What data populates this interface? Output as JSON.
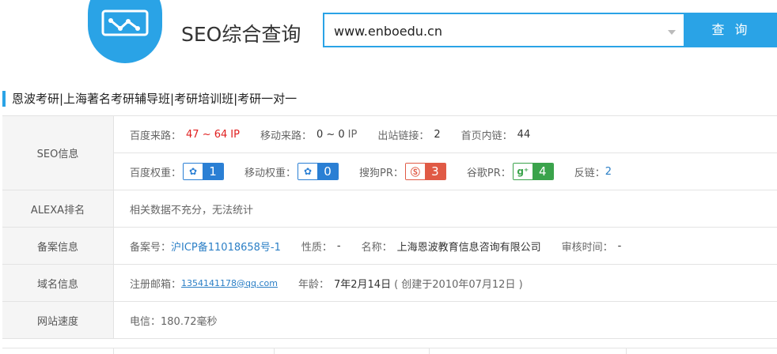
{
  "header": {
    "title": "SEO综合查询",
    "search_value": "www.enboedu.cn",
    "search_button": "查 询"
  },
  "site_title": "恩波考研|上海著名考研辅导班|考研培训班|考研一对一",
  "seo": {
    "label": "SEO信息",
    "baidu_traffic_label": "百度来路：",
    "baidu_traffic_value": "47 ~ 64",
    "baidu_traffic_unit": "IP",
    "mobile_traffic_label": "移动来路：",
    "mobile_traffic_value": "0 ~ 0",
    "mobile_traffic_unit": "IP",
    "outlinks_label": "出站链接：",
    "outlinks_value": "2",
    "inner_links_label": "首页内链：",
    "inner_links_value": "44",
    "baidu_weight_label": "百度权重：",
    "baidu_weight_value": "1",
    "mobile_weight_label": "移动权重：",
    "mobile_weight_value": "0",
    "sogou_pr_label": "搜狗PR：",
    "sogou_pr_value": "3",
    "google_pr_label": "谷歌PR：",
    "google_pr_value": "4",
    "backlinks_label": "反链：",
    "backlinks_value": "2"
  },
  "alexa": {
    "label": "ALEXA排名",
    "text": "相关数据不充分，无法统计"
  },
  "icp": {
    "label": "备案信息",
    "number_label": "备案号：",
    "number_value": "沪ICP备11018658号-1",
    "nature_label": "性质：",
    "nature_value": "-",
    "name_label": "名称：",
    "name_value": "上海恩波教育信息咨询有限公司",
    "review_label": "审核时间：",
    "review_value": "-"
  },
  "domain": {
    "label": "域名信息",
    "email_label": "注册邮箱：",
    "email_value": "1354141178@qq.com",
    "age_label": "年龄：",
    "age_value": "7年2月14日",
    "created": "( 创建于2010年07月12日 )"
  },
  "speed": {
    "label": "网站速度",
    "text": "电信：180.72毫秒"
  },
  "colors": {
    "accent": "#2aa3e6",
    "red": "#e02020",
    "link": "#2b7fc6"
  }
}
